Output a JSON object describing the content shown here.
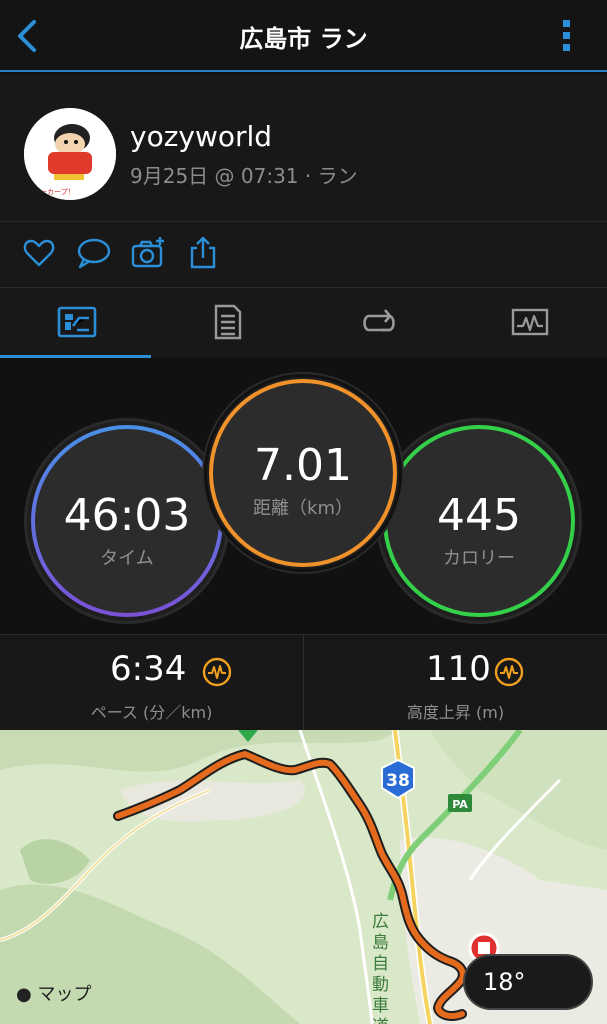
{
  "header": {
    "title": "広島市 ラン"
  },
  "profile": {
    "username": "yozyworld",
    "subtitle": "9月25日 @ 07:31 · ラン",
    "avatar_caption": "ーカープ！"
  },
  "actions": [
    "heart-icon",
    "comment-icon",
    "camera-add-icon",
    "share-icon"
  ],
  "tabs": [
    "overview",
    "details",
    "laps",
    "charts"
  ],
  "summary": {
    "time": {
      "value": "46:03",
      "label": "タイム"
    },
    "distance": {
      "value": "7.01",
      "label": "距離（km）"
    },
    "calories": {
      "value": "445",
      "label": "カロリー"
    }
  },
  "stats": {
    "pace": {
      "value": "6:34",
      "label": "ペース (分／km)"
    },
    "elevation": {
      "value": "110",
      "label": "高度上昇 (m)"
    }
  },
  "map": {
    "route_badge": "38",
    "pa_label": "PA",
    "road_label": "広島自動車道",
    "attribution": "マップ",
    "temperature": "18°"
  },
  "colors": {
    "accent": "#2b8fd8",
    "time_ring": "#4a7fe0",
    "distance_ring": "#f0922b",
    "calories_ring": "#34d04a",
    "route": "#e46a1e"
  }
}
